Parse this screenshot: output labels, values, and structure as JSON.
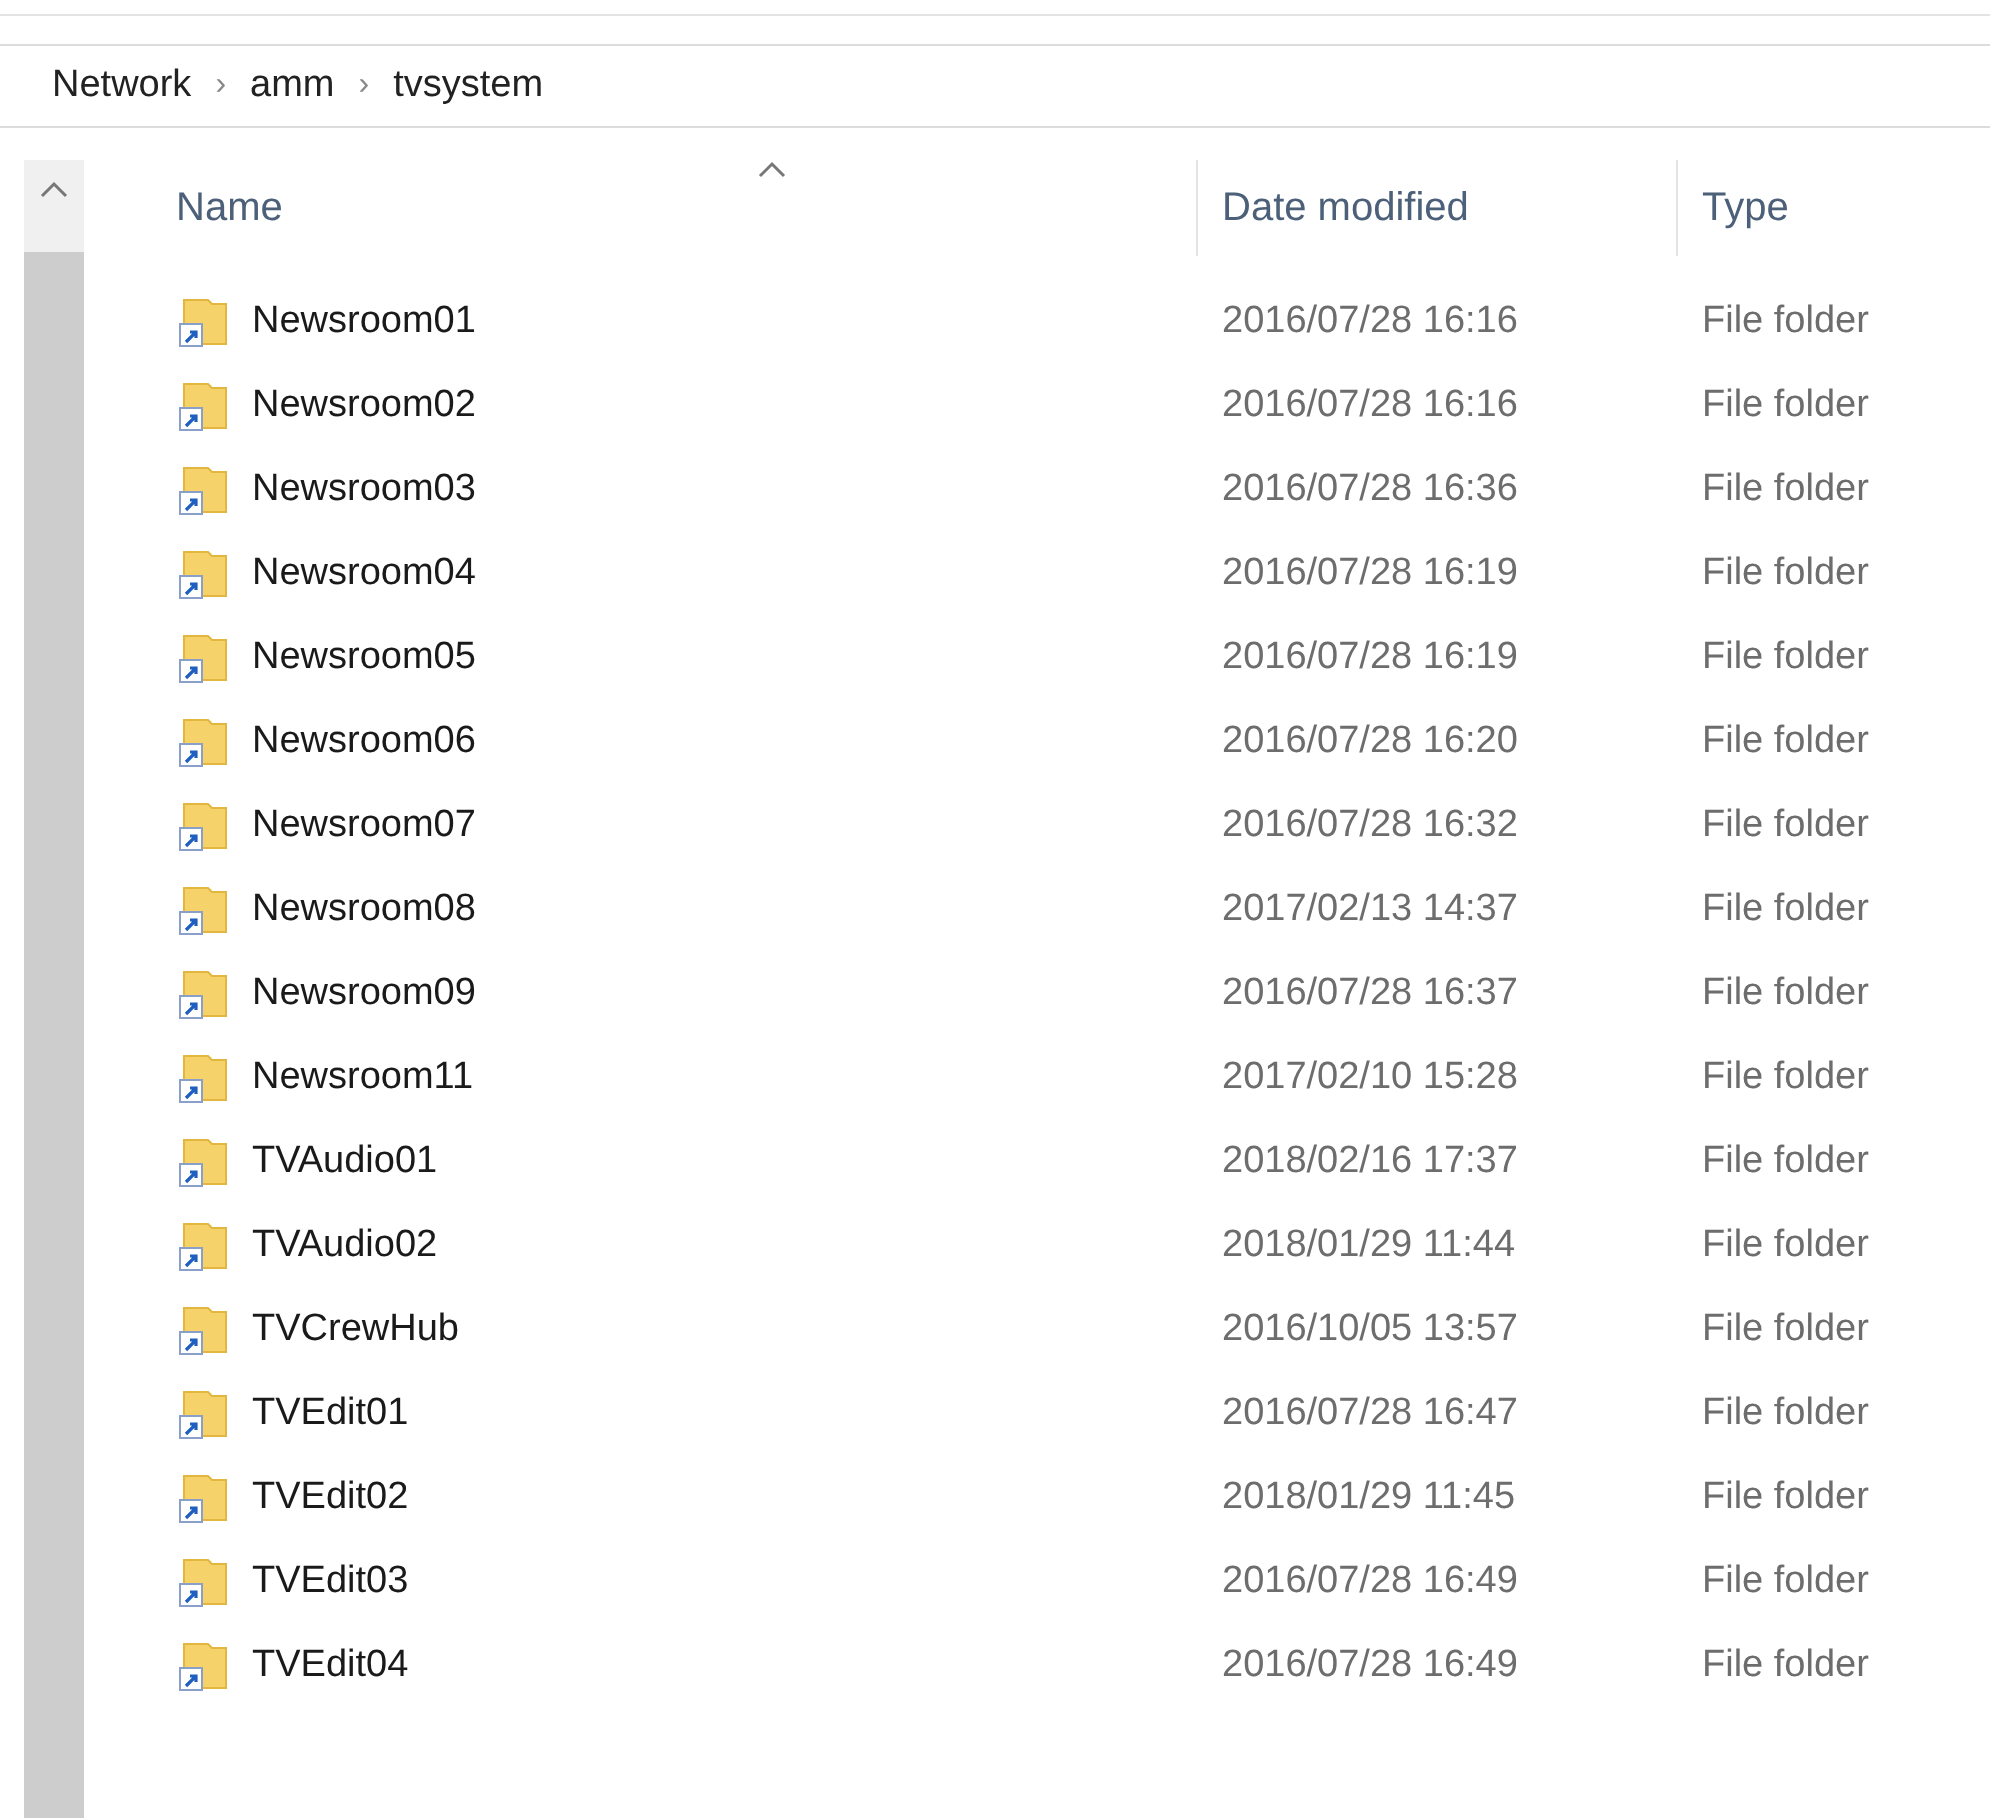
{
  "breadcrumb": {
    "items": [
      "Network",
      "amm",
      "tvsystem"
    ],
    "separator": "›"
  },
  "table": {
    "columns": [
      {
        "label": "Name",
        "sorted": true
      },
      {
        "label": "Date modified",
        "sorted": false
      },
      {
        "label": "Type",
        "sorted": false
      }
    ],
    "rows": [
      {
        "name": "Newsroom01",
        "date": "2016/07/28 16:16",
        "type": "File folder"
      },
      {
        "name": "Newsroom02",
        "date": "2016/07/28 16:16",
        "type": "File folder"
      },
      {
        "name": "Newsroom03",
        "date": "2016/07/28 16:36",
        "type": "File folder"
      },
      {
        "name": "Newsroom04",
        "date": "2016/07/28 16:19",
        "type": "File folder"
      },
      {
        "name": "Newsroom05",
        "date": "2016/07/28 16:19",
        "type": "File folder"
      },
      {
        "name": "Newsroom06",
        "date": "2016/07/28 16:20",
        "type": "File folder"
      },
      {
        "name": "Newsroom07",
        "date": "2016/07/28 16:32",
        "type": "File folder"
      },
      {
        "name": "Newsroom08",
        "date": "2017/02/13 14:37",
        "type": "File folder"
      },
      {
        "name": "Newsroom09",
        "date": "2016/07/28 16:37",
        "type": "File folder"
      },
      {
        "name": "Newsroom11",
        "date": "2017/02/10 15:28",
        "type": "File folder"
      },
      {
        "name": "TVAudio01",
        "date": "2018/02/16 17:37",
        "type": "File folder"
      },
      {
        "name": "TVAudio02",
        "date": "2018/01/29 11:44",
        "type": "File folder"
      },
      {
        "name": "TVCrewHub",
        "date": "2016/10/05 13:57",
        "type": "File folder"
      },
      {
        "name": "TVEdit01",
        "date": "2016/07/28 16:47",
        "type": "File folder"
      },
      {
        "name": "TVEdit02",
        "date": "2018/01/29 11:45",
        "type": "File folder"
      },
      {
        "name": "TVEdit03",
        "date": "2016/07/28 16:49",
        "type": "File folder"
      },
      {
        "name": "TVEdit04",
        "date": "2016/07/28 16:49",
        "type": "File folder"
      }
    ]
  }
}
